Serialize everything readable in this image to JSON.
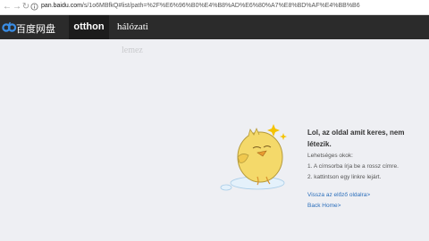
{
  "browser": {
    "url_host": "pan.baidu.com",
    "url_path": "/s/1o6MBfkQ#list/path=%2F%E6%96%B0%E4%B8%AD%E6%80%A7%E8%BD%AF%E4%BB%B6"
  },
  "header": {
    "brand": "百度网盘",
    "tab_home": "otthon",
    "tab_network": "hálózati"
  },
  "subnav": {
    "label": "lemez"
  },
  "error": {
    "title": "Lol, az oldal amit keres, nem létezik.",
    "reasons_heading": "Lehetséges okok:",
    "reasons": [
      "1. A címsorba írja be a rossz címre.",
      "2. kattintson egy linkre lejárt."
    ],
    "back_link": "Vissza az előző oldalra>",
    "home_link": "Back Home>"
  },
  "colors": {
    "header_bg": "#2b2b2b",
    "active_tab_bg": "#1c1c1c",
    "page_bg": "#eeeff3",
    "link": "#2a6ebb",
    "chick_yellow": "#f4d96a"
  },
  "icons": [
    "back-arrow-icon",
    "forward-arrow-icon",
    "reload-icon",
    "lock-icon",
    "baidu-cloud-logo-icon",
    "chick-illustration"
  ]
}
